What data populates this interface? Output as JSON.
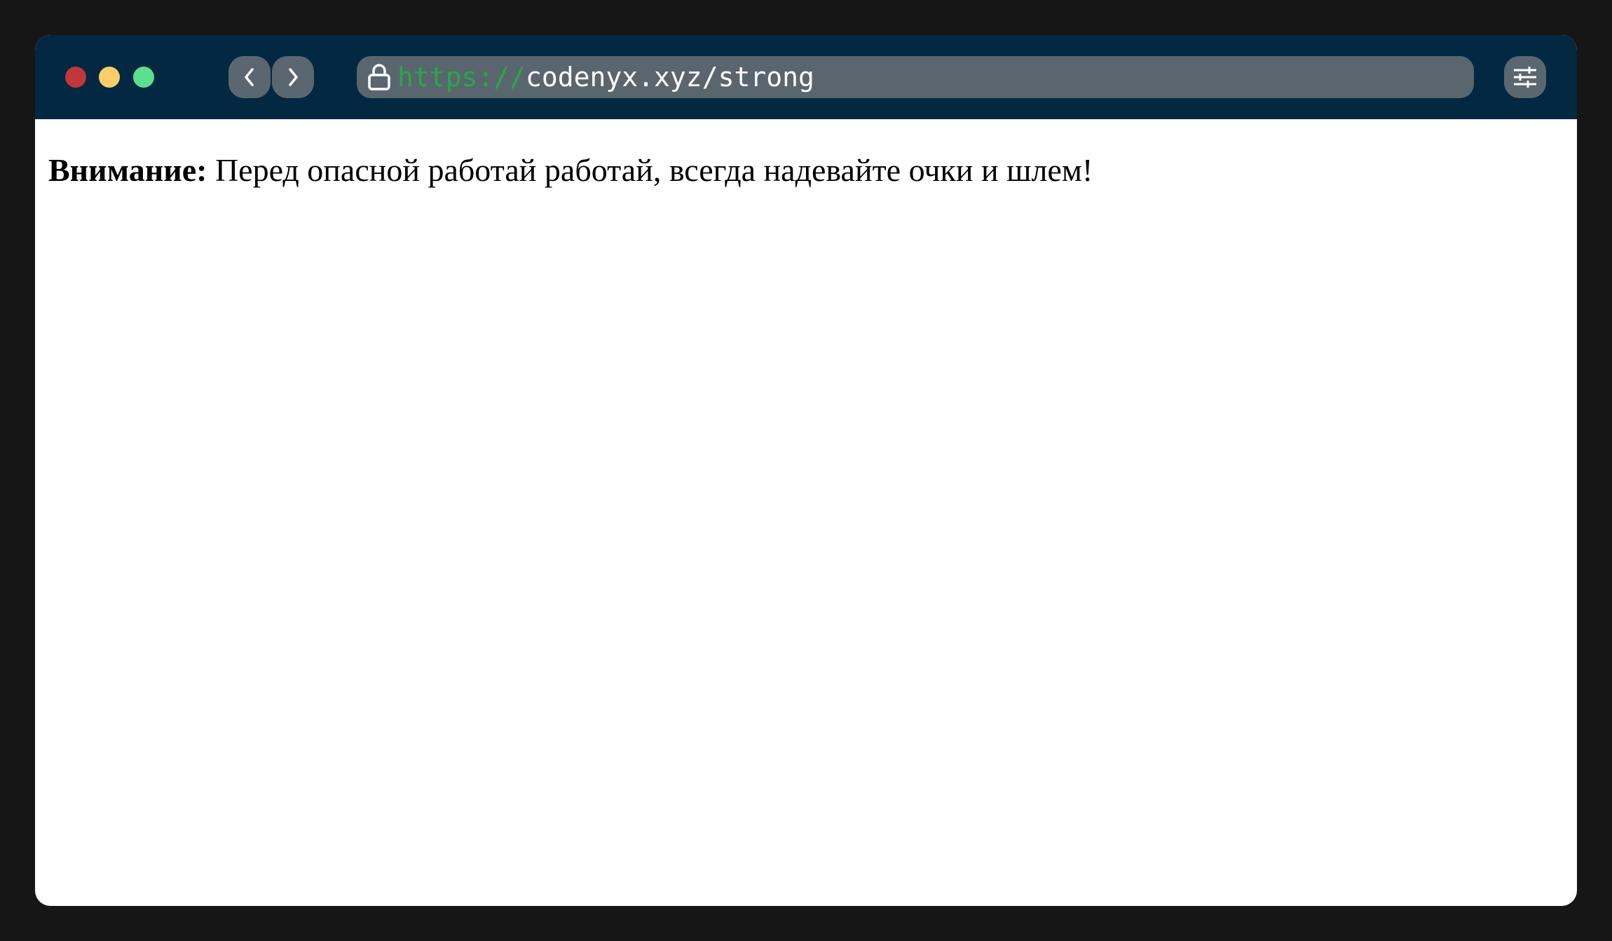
{
  "browser": {
    "url_scheme": "https://",
    "url_rest": "codenyx.xyz/strong"
  },
  "page": {
    "strong_text": "Внимание:",
    "body_text": " Перед опасной работай работай, всегда надевайте очки и шлем!"
  },
  "icons": {
    "back": "chevron-left-icon",
    "forward": "chevron-right-icon",
    "lock": "lock-icon",
    "settings": "sliders-icon"
  },
  "colors": {
    "outer_background": "#161616",
    "toolbar": "#032842",
    "control": "#5b6770",
    "url_scheme": "#2aa64a",
    "traffic_red": "#c0383a",
    "traffic_yellow": "#fbcd6a",
    "traffic_green": "#5ce08e"
  }
}
